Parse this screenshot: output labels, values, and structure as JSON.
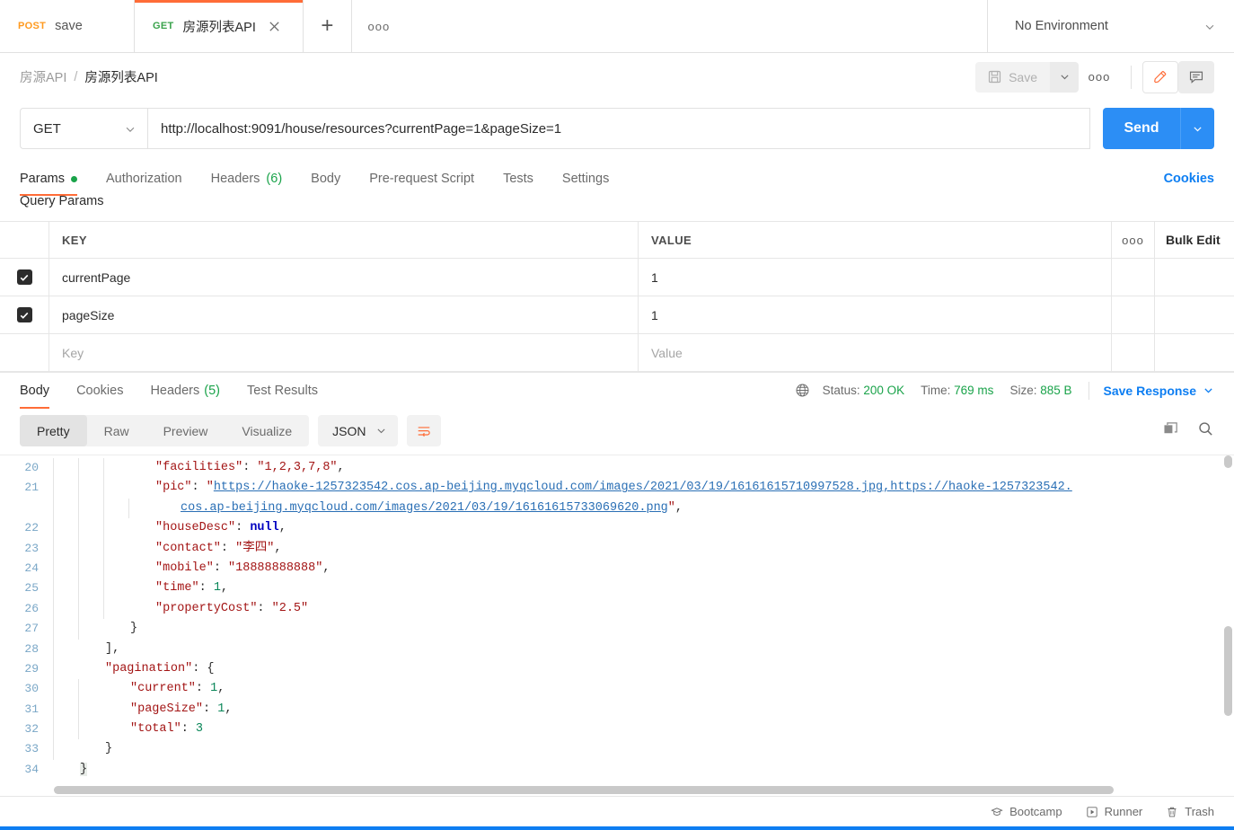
{
  "tabs": [
    {
      "method": "POST",
      "title": "save",
      "active": false
    },
    {
      "method": "GET",
      "title": "房源列表API",
      "active": true
    }
  ],
  "tabbar": {
    "new_tab_icon": "plus-icon",
    "more_icon": "ellipsis-icon",
    "close_icon": "close-icon"
  },
  "environment": {
    "label": "No Environment",
    "icon": "chevron-down-icon"
  },
  "breadcrumb": {
    "parent": "房源API",
    "separator": "/",
    "current": "房源列表API"
  },
  "toolbar": {
    "save_label": "Save",
    "save_icon": "floppy-disk-icon",
    "save_caret_icon": "chevron-down-icon",
    "more_icon": "ellipsis-icon",
    "edit_icon": "pencil-icon",
    "comment_icon": "comment-icon"
  },
  "request": {
    "method": "GET",
    "method_caret_icon": "chevron-down-icon",
    "url": "http://localhost:9091/house/resources?currentPage=1&pageSize=1",
    "send_label": "Send",
    "send_caret_icon": "chevron-down-icon"
  },
  "request_tabs": [
    {
      "label": "Params",
      "dot": true,
      "active": true
    },
    {
      "label": "Authorization",
      "active": false
    },
    {
      "label": "Headers",
      "count": "(6)",
      "active": false
    },
    {
      "label": "Body",
      "active": false
    },
    {
      "label": "Pre-request Script",
      "active": false
    },
    {
      "label": "Tests",
      "active": false
    },
    {
      "label": "Settings",
      "active": false
    }
  ],
  "cookies_link": "Cookies",
  "params": {
    "section_title": "Query Params",
    "columns": {
      "key": "KEY",
      "value": "VALUE"
    },
    "more_icon": "ellipsis-icon",
    "bulk_edit": "Bulk Edit",
    "rows": [
      {
        "checked": true,
        "key": "currentPage",
        "value": "1"
      },
      {
        "checked": true,
        "key": "pageSize",
        "value": "1"
      }
    ],
    "placeholder_row": {
      "key": "Key",
      "value": "Value"
    }
  },
  "response_tabs": [
    {
      "label": "Body",
      "active": true
    },
    {
      "label": "Cookies",
      "active": false
    },
    {
      "label": "Headers",
      "count": "(5)",
      "active": false
    },
    {
      "label": "Test Results",
      "active": false
    }
  ],
  "response_meta": {
    "globe_icon": "globe-icon",
    "status_label": "Status:",
    "status_value": "200 OK",
    "time_label": "Time:",
    "time_value": "769 ms",
    "size_label": "Size:",
    "size_value": "885 B",
    "save_response": "Save Response",
    "save_response_caret_icon": "chevron-down-icon"
  },
  "format_bar": {
    "views": [
      "Pretty",
      "Raw",
      "Preview",
      "Visualize"
    ],
    "active_view": "Pretty",
    "language": "JSON",
    "language_caret_icon": "chevron-down-icon",
    "wrap_icon": "word-wrap-icon",
    "copy_icon": "copy-icon",
    "search_icon": "search-icon"
  },
  "response_body": {
    "lines": [
      {
        "num": "20",
        "indent": 3,
        "tokens": [
          {
            "t": "\"facilities\"",
            "c": "k"
          },
          {
            "t": ": ",
            "c": "p"
          },
          {
            "t": "\"1,2,3,7,8\"",
            "c": "s"
          },
          {
            "t": ",",
            "c": "p"
          }
        ]
      },
      {
        "num": "21",
        "indent": 3,
        "tokens": [
          {
            "t": "\"pic\"",
            "c": "k"
          },
          {
            "t": ": ",
            "c": "p"
          },
          {
            "t": "\"",
            "c": "s"
          },
          {
            "t": "https://haoke-1257323542.cos.ap-beijing.myqcloud.com/images/2021/03/19/16161615710997528.jpg,https://haoke-1257323542.",
            "c": "lnk"
          }
        ]
      },
      {
        "num": "",
        "indent": 4,
        "wrapped": true,
        "tokens": [
          {
            "t": "cos.ap-beijing.myqcloud.com/images/2021/03/19/16161615733069620.png",
            "c": "lnk"
          },
          {
            "t": "\"",
            "c": "s"
          },
          {
            "t": ",",
            "c": "p"
          }
        ]
      },
      {
        "num": "22",
        "indent": 3,
        "tokens": [
          {
            "t": "\"houseDesc\"",
            "c": "k"
          },
          {
            "t": ": ",
            "c": "p"
          },
          {
            "t": "null",
            "c": "nul"
          },
          {
            "t": ",",
            "c": "p"
          }
        ]
      },
      {
        "num": "23",
        "indent": 3,
        "tokens": [
          {
            "t": "\"contact\"",
            "c": "k"
          },
          {
            "t": ": ",
            "c": "p"
          },
          {
            "t": "\"李四\"",
            "c": "s"
          },
          {
            "t": ",",
            "c": "p"
          }
        ]
      },
      {
        "num": "24",
        "indent": 3,
        "tokens": [
          {
            "t": "\"mobile\"",
            "c": "k"
          },
          {
            "t": ": ",
            "c": "p"
          },
          {
            "t": "\"18888888888\"",
            "c": "s"
          },
          {
            "t": ",",
            "c": "p"
          }
        ]
      },
      {
        "num": "25",
        "indent": 3,
        "tokens": [
          {
            "t": "\"time\"",
            "c": "k"
          },
          {
            "t": ": ",
            "c": "p"
          },
          {
            "t": "1",
            "c": "n"
          },
          {
            "t": ",",
            "c": "p"
          }
        ]
      },
      {
        "num": "26",
        "indent": 3,
        "tokens": [
          {
            "t": "\"propertyCost\"",
            "c": "k"
          },
          {
            "t": ": ",
            "c": "p"
          },
          {
            "t": "\"2.5\"",
            "c": "s"
          }
        ]
      },
      {
        "num": "27",
        "indent": 2,
        "tokens": [
          {
            "t": "}",
            "c": "brk"
          }
        ]
      },
      {
        "num": "28",
        "indent": 1,
        "tokens": [
          {
            "t": "],",
            "c": "brk"
          }
        ]
      },
      {
        "num": "29",
        "indent": 1,
        "tokens": [
          {
            "t": "\"pagination\"",
            "c": "k"
          },
          {
            "t": ": ",
            "c": "p"
          },
          {
            "t": "{",
            "c": "brk"
          }
        ]
      },
      {
        "num": "30",
        "indent": 2,
        "tokens": [
          {
            "t": "\"current\"",
            "c": "k"
          },
          {
            "t": ": ",
            "c": "p"
          },
          {
            "t": "1",
            "c": "n"
          },
          {
            "t": ",",
            "c": "p"
          }
        ]
      },
      {
        "num": "31",
        "indent": 2,
        "tokens": [
          {
            "t": "\"pageSize\"",
            "c": "k"
          },
          {
            "t": ": ",
            "c": "p"
          },
          {
            "t": "1",
            "c": "n"
          },
          {
            "t": ",",
            "c": "p"
          }
        ]
      },
      {
        "num": "32",
        "indent": 2,
        "tokens": [
          {
            "t": "\"total\"",
            "c": "k"
          },
          {
            "t": ": ",
            "c": "p"
          },
          {
            "t": "3",
            "c": "n"
          }
        ]
      },
      {
        "num": "33",
        "indent": 1,
        "tokens": [
          {
            "t": "}",
            "c": "brk"
          }
        ]
      },
      {
        "num": "34",
        "indent": 0,
        "selected": true,
        "tokens": [
          {
            "t": "}",
            "c": "brk"
          }
        ]
      }
    ]
  },
  "footer": {
    "items": [
      {
        "label": "Bootcamp",
        "icon": "graduation-cap-icon"
      },
      {
        "label": "Runner",
        "icon": "play-icon"
      },
      {
        "label": "Trash",
        "icon": "trash-icon"
      }
    ]
  }
}
